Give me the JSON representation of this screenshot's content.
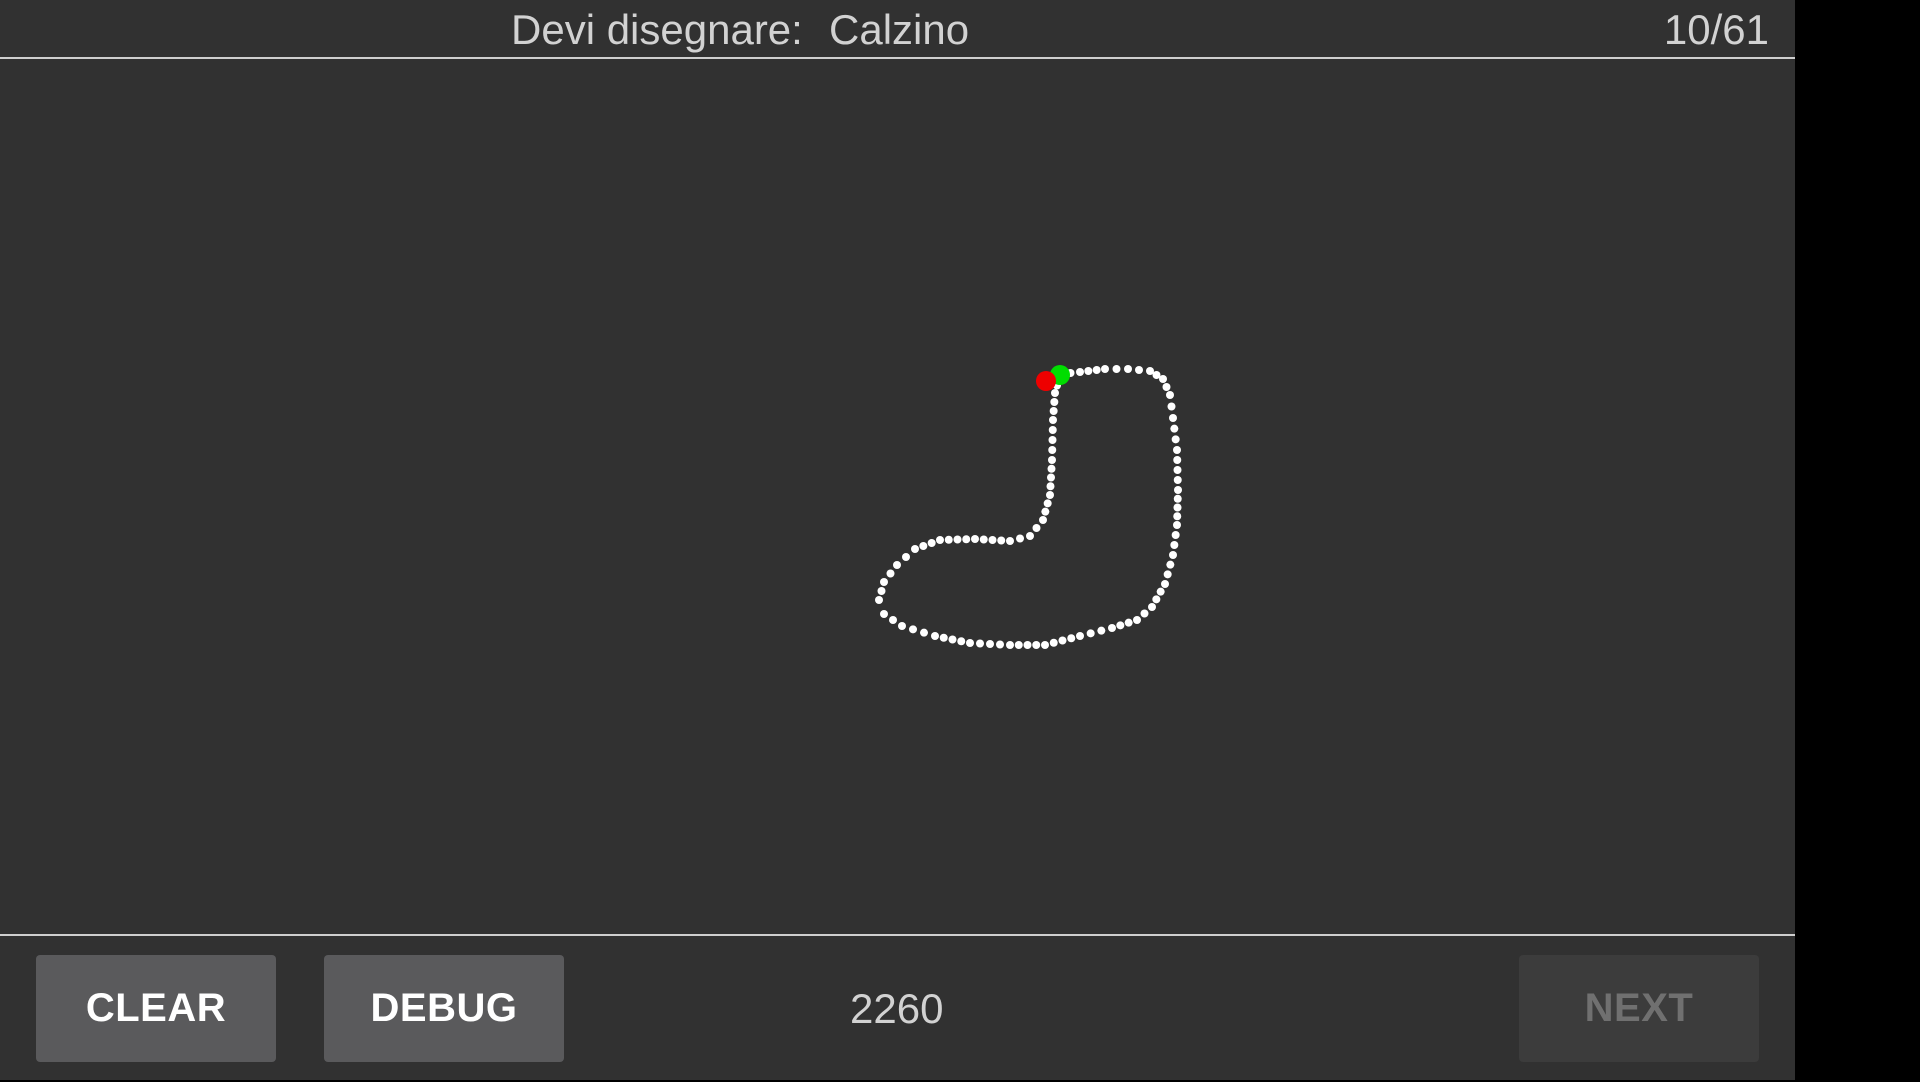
{
  "header": {
    "prompt_label": "Devi disegnare:",
    "prompt_word": "Calzino",
    "counter": "10/61"
  },
  "canvas": {
    "background": "#313131",
    "stroke_color": "#ffffff",
    "start_marker_color": "#00dd00",
    "end_marker_color": "#ee0000"
  },
  "footer": {
    "clear_label": "CLEAR",
    "debug_label": "DEBUG",
    "score": "2260",
    "next_label": "NEXT"
  }
}
